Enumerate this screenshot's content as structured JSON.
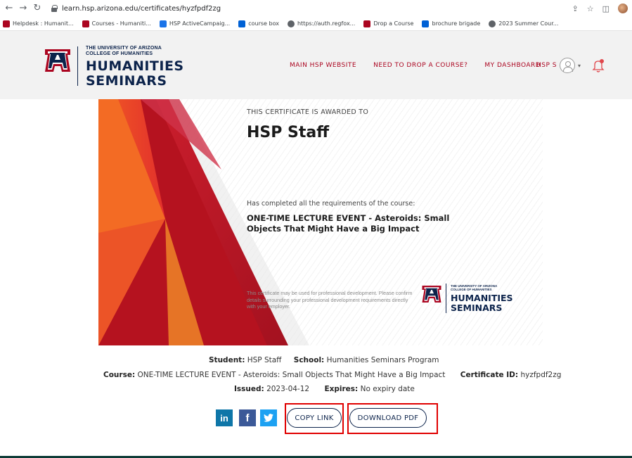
{
  "browser": {
    "url": "learn.hsp.arizona.edu/certificates/hyzfpdf2zg",
    "bookmarks": [
      {
        "label": "Helpdesk : Humanit...",
        "icon": "ua-icon"
      },
      {
        "label": "Courses - Humaniti...",
        "icon": "ua-icon"
      },
      {
        "label": "HSP ActiveCampaig...",
        "icon": "hsp-icon"
      },
      {
        "label": "course box",
        "icon": "box-icon"
      },
      {
        "label": "https://auth.regfox...",
        "icon": "globe-icon"
      },
      {
        "label": "Drop a Course",
        "icon": "ua-icon"
      },
      {
        "label": "brochure brigade",
        "icon": "box-icon"
      },
      {
        "label": "2023 Summer Cour...",
        "icon": "globe-icon"
      }
    ]
  },
  "header": {
    "logo_small_line1": "THE UNIVERSITY OF ARIZONA",
    "logo_small_line2": "COLLEGE OF HUMANITIES",
    "logo_big_line1": "HUMANITIES",
    "logo_big_line2": "SEMINARS",
    "nav": [
      "MAIN HSP WEBSITE",
      "NEED TO DROP A COURSE?",
      "MY DASHBOARD"
    ],
    "user_label": "HSP S"
  },
  "certificate": {
    "awarded_to": "THIS CERTIFICATE IS AWARDED TO",
    "name": "HSP Staff",
    "completed_text": "Has completed all the requirements of the course:",
    "course_title": "ONE-TIME LECTURE EVENT - Asteroids: Small Objects That Might Have a Big Impact",
    "note": "This certificate may be used for professional development. Please confirm details surrounding your professional development requirements directly with your employer.",
    "logo_small_line1": "THE UNIVERSITY OF ARIZONA",
    "logo_small_line2": "COLLEGE OF HUMANITIES",
    "logo_big_line1": "HUMANITIES",
    "logo_big_line2": "SEMINARS"
  },
  "info": {
    "student_label": "Student:",
    "student_value": "HSP Staff",
    "school_label": "School:",
    "school_value": "Humanities Seminars Program",
    "course_label": "Course:",
    "course_value": "ONE-TIME LECTURE EVENT - Asteroids: Small Objects That Might Have a Big Impact",
    "cert_id_label": "Certificate ID:",
    "cert_id_value": "hyzfpdf2zg",
    "issued_label": "Issued:",
    "issued_value": "2023-04-12",
    "expires_label": "Expires:",
    "expires_value": "No expiry date"
  },
  "share": {
    "linkedin": "in",
    "facebook": "f",
    "copy_link": "COPY LINK",
    "download_pdf": "DOWNLOAD PDF"
  },
  "colors": {
    "brand_navy": "#0c234b",
    "brand_red": "#ab0520",
    "highlight": "#e00000"
  }
}
